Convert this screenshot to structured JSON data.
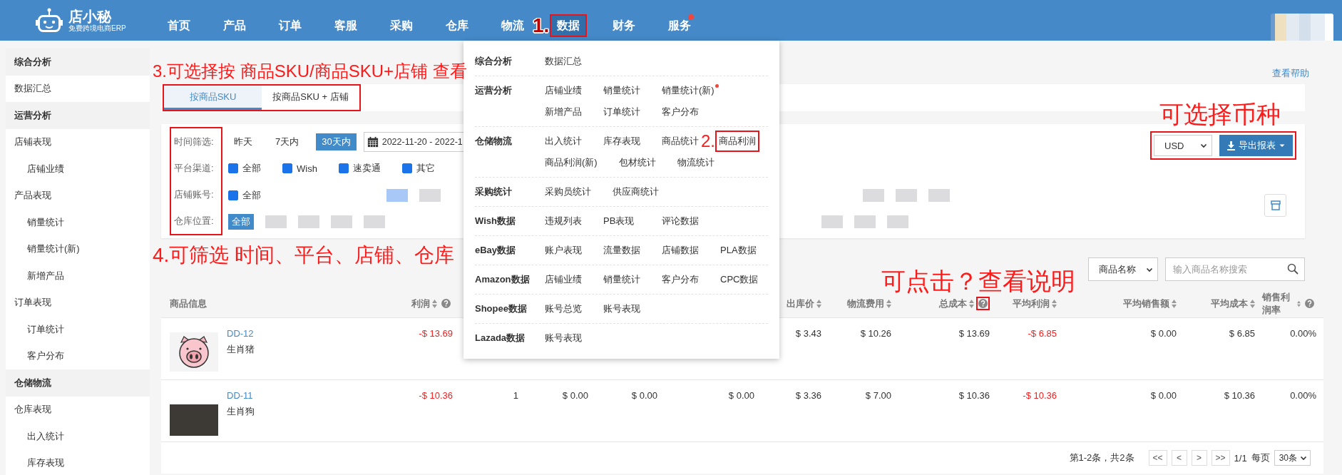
{
  "header": {
    "logo_name": "店小秘",
    "logo_tagline": "免费跨境电商ERP",
    "nav": [
      {
        "label": "首页",
        "selected": false,
        "badge": false,
        "boxed": false
      },
      {
        "label": "产品",
        "selected": false,
        "badge": false,
        "boxed": false
      },
      {
        "label": "订单",
        "selected": false,
        "badge": false,
        "boxed": false
      },
      {
        "label": "客服",
        "selected": false,
        "badge": false,
        "boxed": false
      },
      {
        "label": "采购",
        "selected": false,
        "badge": false,
        "boxed": false
      },
      {
        "label": "仓库",
        "selected": false,
        "badge": false,
        "boxed": false
      },
      {
        "label": "物流",
        "selected": false,
        "badge": false,
        "boxed": false
      },
      {
        "label": "数据",
        "selected": true,
        "badge": false,
        "boxed": true
      },
      {
        "label": "财务",
        "selected": false,
        "badge": false,
        "boxed": false
      },
      {
        "label": "服务",
        "selected": false,
        "badge": true,
        "boxed": false
      }
    ]
  },
  "sidebar": {
    "items": [
      {
        "label": "综合分析",
        "children": [
          {
            "label": "数据汇总"
          }
        ]
      },
      {
        "label": "运营分析",
        "children": [
          {
            "label": "店铺表现",
            "children": [
              {
                "label": "店铺业绩"
              }
            ]
          },
          {
            "label": "产品表现",
            "children": [
              {
                "label": "销量统计"
              },
              {
                "label": "销量统计(新)"
              },
              {
                "label": "新增产品"
              }
            ]
          },
          {
            "label": "订单表现",
            "children": [
              {
                "label": "订单统计"
              },
              {
                "label": "客户分布"
              }
            ]
          }
        ]
      },
      {
        "label": "仓储物流",
        "children": [
          {
            "label": "仓库表现",
            "children": [
              {
                "label": "出入统计"
              },
              {
                "label": "库存表现"
              }
            ]
          }
        ]
      }
    ]
  },
  "help_link": "查看帮助",
  "view_tabs": {
    "boxed": true,
    "tabs": [
      {
        "label": "按商品SKU",
        "selected": true
      },
      {
        "label": "按商品SKU + 店铺",
        "selected": false
      }
    ]
  },
  "filters": {
    "labels_boxed": true,
    "rows": [
      {
        "label": "时间筛选:",
        "kind": "time",
        "options": [
          {
            "label": "昨天",
            "selected": false
          },
          {
            "label": "7天内",
            "selected": false
          },
          {
            "label": "30天内",
            "selected": true
          }
        ],
        "date_range": "2022-11-20 - 2022-1"
      },
      {
        "label": "平台渠道:",
        "kind": "checkboxes",
        "options": [
          {
            "label": "全部",
            "checked": true
          },
          {
            "label": "Wish",
            "checked": true
          },
          {
            "label": "速卖通",
            "checked": true
          },
          {
            "label": "其它",
            "checked": true
          }
        ]
      },
      {
        "label": "店铺账号:",
        "kind": "checkboxes",
        "options": [
          {
            "label": "全部",
            "checked": true
          }
        ]
      },
      {
        "label": "仓库位置:",
        "kind": "tags",
        "options": [
          {
            "label": "全部",
            "selected": true
          }
        ]
      }
    ]
  },
  "actions": {
    "boxed": true,
    "currency": "USD",
    "export_button": "导出报表"
  },
  "search": {
    "field_select": "商品名称",
    "placeholder": "输入商品名称搜索"
  },
  "table": {
    "columns": [
      {
        "label": "商品信息",
        "sortable": false,
        "help": false
      },
      {
        "label": "利润",
        "sortable": true,
        "help": true,
        "help_boxed": false
      },
      null,
      null,
      null,
      null,
      {
        "label": "出库价",
        "sortable": true,
        "help": false
      },
      {
        "label": "物流费用",
        "sortable": true,
        "help": false
      },
      {
        "label": "总成本",
        "sortable": true,
        "help": true,
        "help_boxed": true
      },
      {
        "label": "平均利润",
        "sortable": true,
        "help": false
      },
      {
        "label": "平均销售额",
        "sortable": true,
        "help": false
      },
      {
        "label": "平均成本",
        "sortable": true,
        "help": false
      },
      {
        "label": "销售利润率",
        "sortable": true,
        "help": true,
        "help_boxed": false
      }
    ],
    "rows": [
      {
        "cells": [
          {
            "kind": "product",
            "sku": "DD-12",
            "name": "生肖猪",
            "image": {
              "kind": "drawing"
            }
          },
          {
            "text": "-$ 13.69",
            "negative": true
          },
          null,
          null,
          null,
          null,
          {
            "text": "$ 3.43",
            "negative": false
          },
          {
            "text": "$ 10.26",
            "negative": false
          },
          {
            "text": "$ 13.69",
            "negative": false
          },
          {
            "text": "-$ 6.85",
            "negative": true
          },
          {
            "text": "$ 0.00",
            "negative": false
          },
          {
            "text": "$ 6.85",
            "negative": false
          },
          {
            "text": "0.00%",
            "negative": false
          }
        ]
      },
      {
        "cells": [
          {
            "kind": "product",
            "sku": "DD-11",
            "name": "生肖狗",
            "image": {
              "kind": "photo"
            }
          },
          {
            "text": "-$ 10.36",
            "negative": true
          },
          {
            "text": "1",
            "negative": false
          },
          {
            "text": "$ 0.00",
            "negative": false
          },
          {
            "text": "$ 0.00",
            "negative": false
          },
          {
            "text": "$ 0.00",
            "negative": false
          },
          {
            "text": "$ 3.36",
            "negative": false
          },
          {
            "text": "$ 7.00",
            "negative": false
          },
          {
            "text": "$ 10.36",
            "negative": false
          },
          {
            "text": "-$ 10.36",
            "negative": true
          },
          {
            "text": "$ 0.00",
            "negative": false
          },
          {
            "text": "$ 10.36",
            "negative": false
          },
          {
            "text": "0.00%",
            "negative": false
          }
        ]
      }
    ]
  },
  "pagination": {
    "summary": "第1-2条，共2条",
    "buttons": [
      "<<",
      "<",
      ">",
      ">>"
    ],
    "page": "1/1",
    "per_page_label": "每页",
    "per_page": "30条"
  },
  "data_menu": {
    "groups": [
      {
        "label": "综合分析",
        "items": [
          {
            "label": "数据汇总",
            "badge": false,
            "boxed": false
          }
        ]
      },
      {
        "label": "运营分析",
        "items": [
          {
            "label": "店铺业绩",
            "badge": false,
            "boxed": false
          },
          {
            "label": "销量统计",
            "badge": false,
            "boxed": false
          },
          {
            "label": "销量统计(新)",
            "badge": true,
            "boxed": false
          },
          {
            "label": "新增产品",
            "badge": false,
            "boxed": false
          },
          {
            "label": "订单统计",
            "badge": false,
            "boxed": false
          },
          {
            "label": "客户分布",
            "badge": false,
            "boxed": false
          }
        ]
      },
      {
        "label": "仓储物流",
        "items": [
          {
            "label": "出入统计",
            "badge": false,
            "boxed": false
          },
          {
            "label": "库存表现",
            "badge": false,
            "boxed": false
          },
          {
            "label": "商品统计",
            "badge": false,
            "boxed": false
          },
          {
            "label": "商品利润",
            "badge": false,
            "boxed": true
          },
          {
            "label": "商品利润(新)",
            "badge": false,
            "boxed": false
          },
          {
            "label": "包材统计",
            "badge": false,
            "boxed": false
          },
          {
            "label": "物流统计",
            "badge": false,
            "boxed": false
          }
        ]
      },
      {
        "label": "采购统计",
        "items": [
          {
            "label": "采购员统计",
            "badge": false,
            "boxed": false
          },
          {
            "label": "供应商统计",
            "badge": false,
            "boxed": false
          }
        ]
      },
      {
        "label": "Wish数据",
        "items": [
          {
            "label": "违规列表",
            "badge": false,
            "boxed": false
          },
          {
            "label": "PB表现",
            "badge": false,
            "boxed": false
          },
          {
            "label": "评论数据",
            "badge": false,
            "boxed": false
          }
        ]
      },
      {
        "label": "eBay数据",
        "items": [
          {
            "label": "账户表现",
            "badge": false,
            "boxed": false
          },
          {
            "label": "流量数据",
            "badge": false,
            "boxed": false
          },
          {
            "label": "店铺数据",
            "badge": false,
            "boxed": false
          },
          {
            "label": "PLA数据",
            "badge": false,
            "boxed": false
          }
        ]
      },
      {
        "label": "Amazon数据",
        "items": [
          {
            "label": "店铺业绩",
            "badge": false,
            "boxed": false
          },
          {
            "label": "销量统计",
            "badge": false,
            "boxed": false
          },
          {
            "label": "客户分布",
            "badge": false,
            "boxed": false
          },
          {
            "label": "CPC数据",
            "badge": false,
            "boxed": false
          }
        ]
      },
      {
        "label": "Shopee数据",
        "items": [
          {
            "label": "账号总览",
            "badge": false,
            "boxed": false
          },
          {
            "label": "账号表现",
            "badge": false,
            "boxed": false
          }
        ]
      },
      {
        "label": "Lazada数据",
        "items": [
          {
            "label": "账号表现",
            "badge": false,
            "boxed": false
          }
        ]
      }
    ]
  },
  "annotations": [
    {
      "text": "1."
    },
    {
      "text": "2."
    },
    {
      "text": "3.可选择按 商品SKU/商品SKU+店铺 查看"
    },
    {
      "text": "4.可筛选 时间、平台、店铺、仓库"
    },
    {
      "text": "可选择币种"
    },
    {
      "text": "可点击？查看说明"
    }
  ]
}
